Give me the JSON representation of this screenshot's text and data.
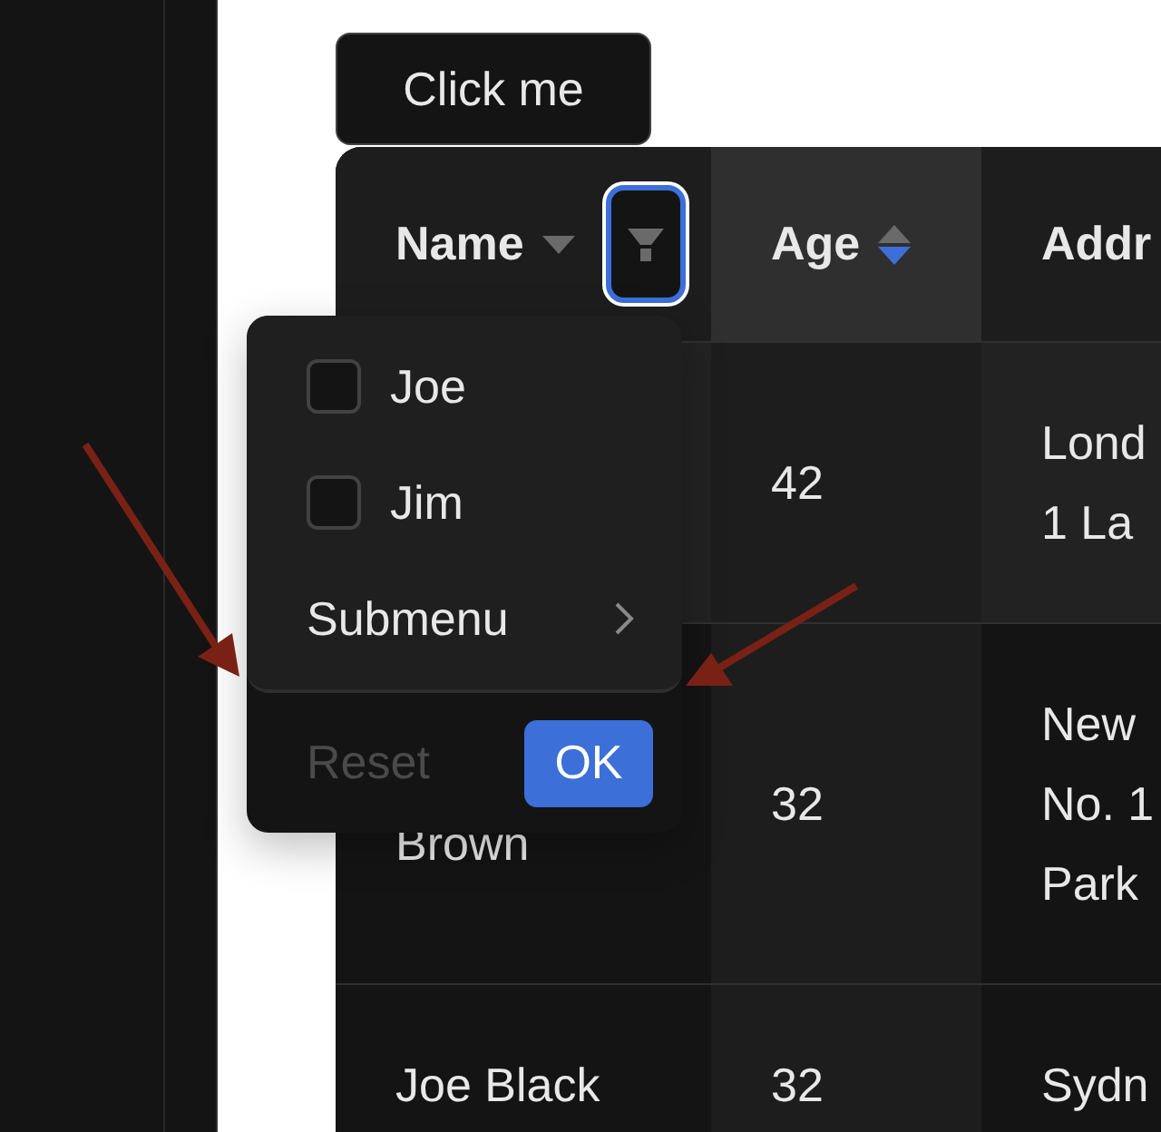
{
  "button": {
    "label": "Click me"
  },
  "table": {
    "columns": [
      {
        "title": "Name",
        "sort_carets": [
          {
            "kind": "down",
            "selected": false
          }
        ],
        "filter": {
          "focused": true
        }
      },
      {
        "title": "Age",
        "sort_carets": [
          {
            "kind": "up",
            "selected": false
          },
          {
            "kind": "down",
            "selected": true
          }
        ]
      },
      {
        "title": "Addr"
      }
    ],
    "rows": [
      {
        "hovered": true,
        "age": "42",
        "address": [
          "Lond",
          "1 La"
        ]
      },
      {
        "hovered": false,
        "name": [
          "Brown"
        ],
        "age": "32",
        "address": [
          "New",
          "No. 1",
          "Park"
        ]
      },
      {
        "hovered": false,
        "name": [
          "Joe Black"
        ],
        "age": "32",
        "address": [
          "Sydn"
        ]
      }
    ]
  },
  "filter_dropdown": {
    "items": [
      {
        "kind": "checkbox",
        "label": "Joe",
        "checked": false
      },
      {
        "kind": "checkbox",
        "label": "Jim",
        "checked": false
      },
      {
        "kind": "submenu",
        "label": "Submenu"
      }
    ],
    "reset": {
      "label": "Reset",
      "disabled": true
    },
    "ok": {
      "label": "OK"
    }
  }
}
